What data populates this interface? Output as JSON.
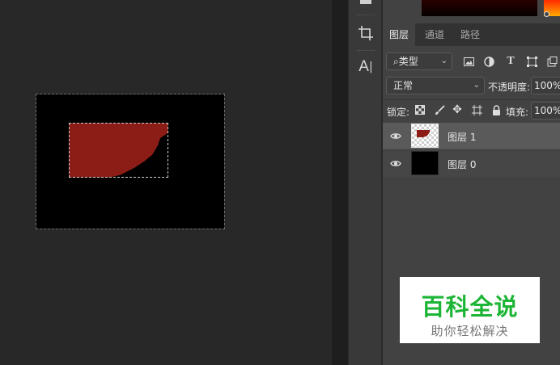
{
  "panel": {
    "tabs": [
      {
        "label": "图层"
      },
      {
        "label": "通道"
      },
      {
        "label": "路径"
      }
    ],
    "filter": {
      "label": "类型",
      "icon": "search-icon"
    },
    "filter_icons": [
      "image-icon",
      "adjustment-icon",
      "text-icon",
      "shape-icon",
      "smart-object-icon"
    ],
    "blend_mode": "正常",
    "opacity_label": "不透明度:",
    "opacity_value": "100%",
    "lock_label": "锁定:",
    "lock_icons": [
      "lock-transparent-icon",
      "lock-brush-icon",
      "lock-move-icon",
      "lock-artboard-icon",
      "lock-all-icon"
    ],
    "fill_label": "填充:",
    "fill_value": "100%",
    "layers": [
      {
        "name": "图层 1",
        "selected": true,
        "visible": true
      },
      {
        "name": "图层 0",
        "selected": false,
        "visible": true
      }
    ]
  },
  "tools": [
    {
      "name": "crop-tool",
      "glyph": "⌗"
    },
    {
      "name": "type-tool",
      "glyph": "A|"
    }
  ],
  "colors": {
    "layer_fill": "#8b1c16",
    "panel_bg": "#424242",
    "selected_row": "#5a5a5a",
    "watermark_green": "#1db536"
  },
  "watermark": {
    "title": "百科全说",
    "subtitle": "助你轻松解决"
  }
}
